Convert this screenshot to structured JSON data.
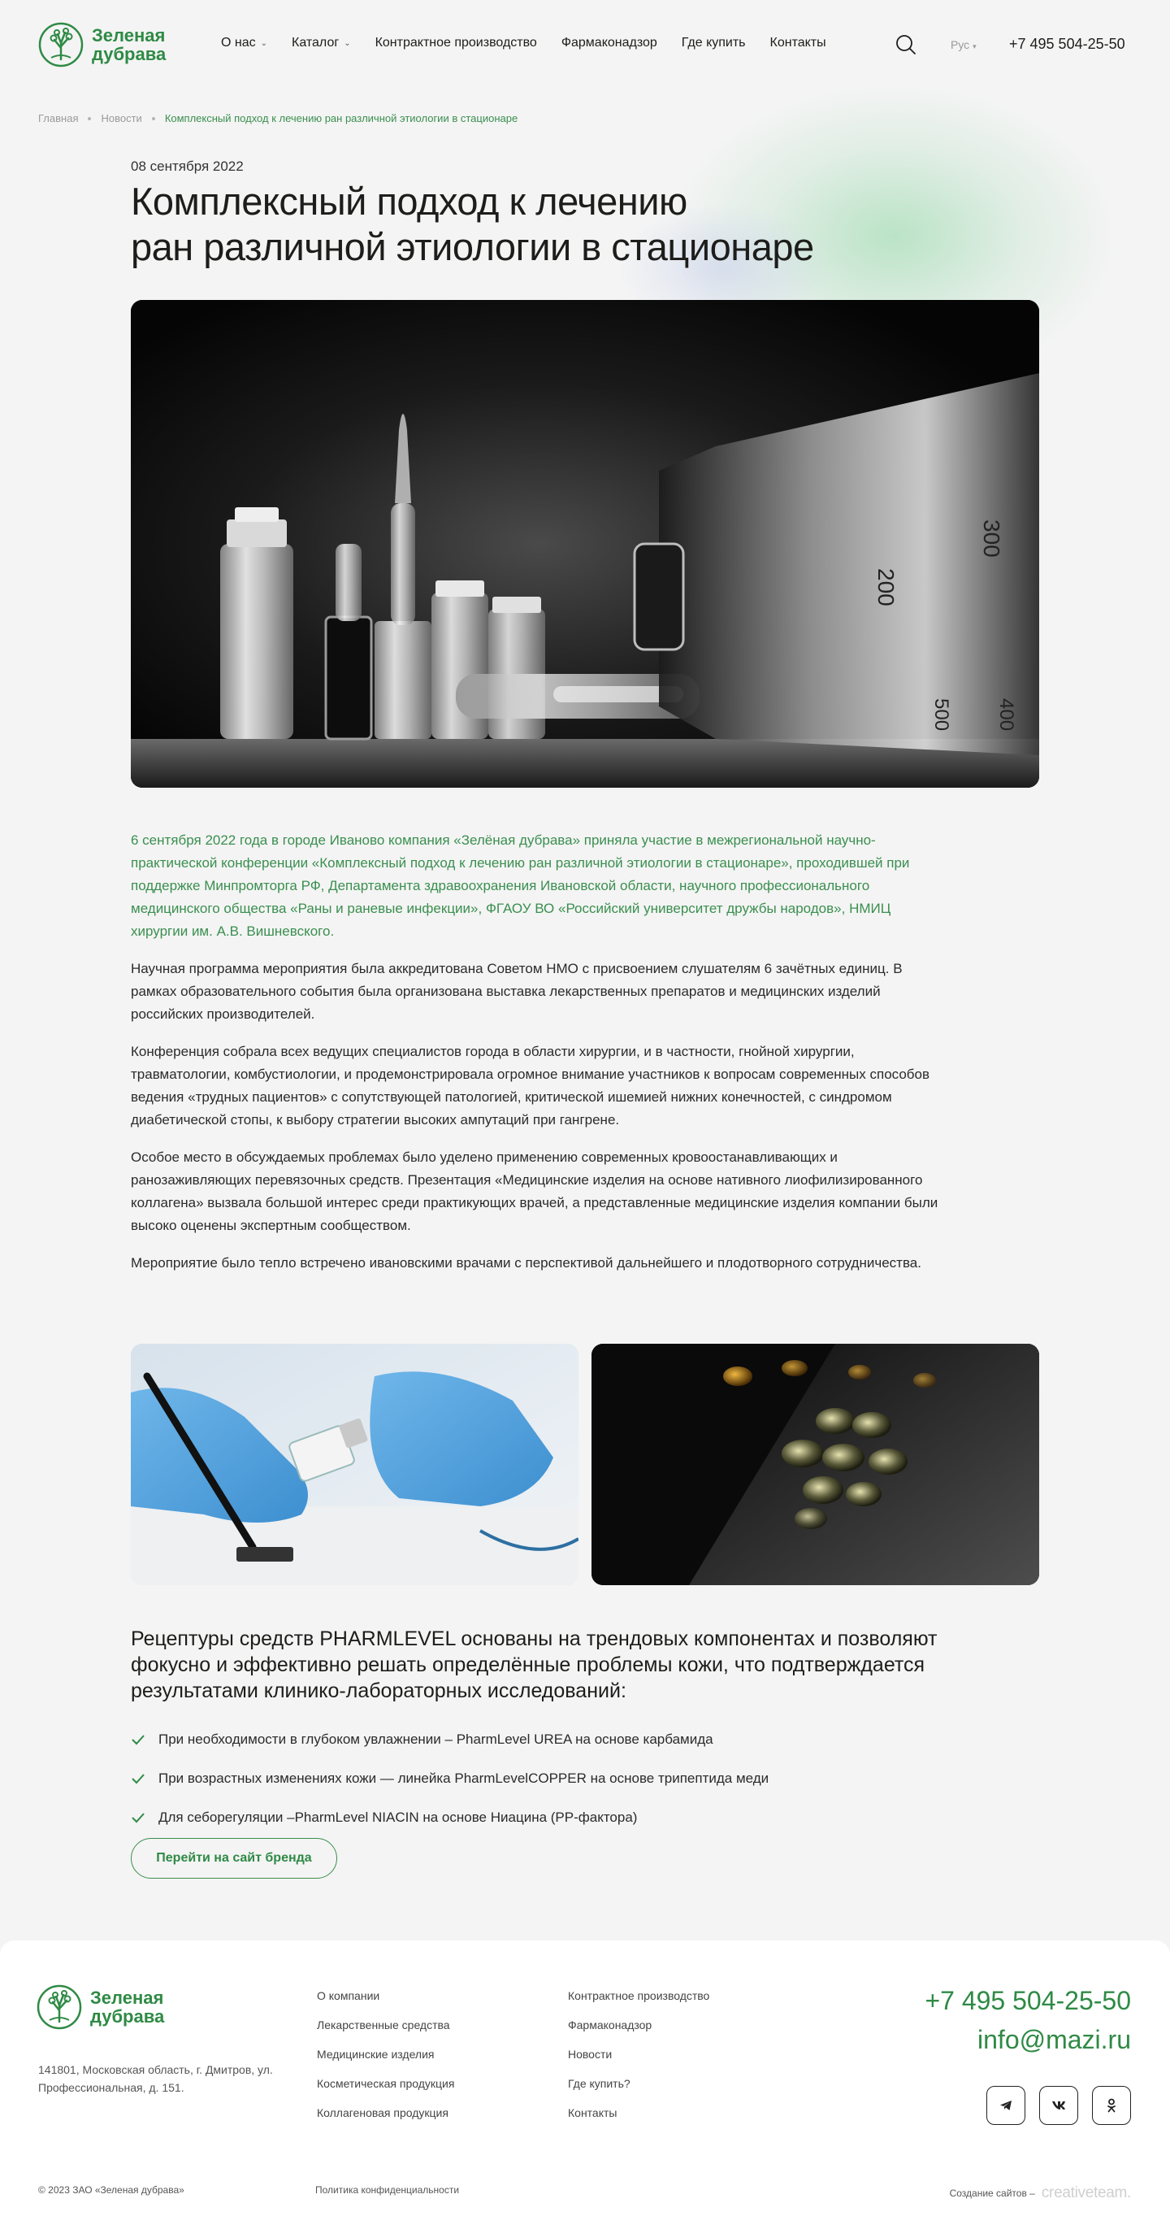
{
  "header": {
    "logo_text": "Зеленая дубрава",
    "nav": [
      {
        "label": "О нас",
        "has_dropdown": true
      },
      {
        "label": "Каталог",
        "has_dropdown": true
      },
      {
        "label": "Контрактное производство",
        "has_dropdown": false
      },
      {
        "label": "Фармаконадзор",
        "has_dropdown": false
      },
      {
        "label": "Где купить",
        "has_dropdown": false
      },
      {
        "label": "Контакты",
        "has_dropdown": false
      }
    ],
    "search_icon": "search-icon",
    "language": "Рус",
    "phone": "+7 495 504-25-50"
  },
  "breadcrumbs": [
    "Главная",
    "Новости",
    "Комплексный подход к лечению ран различной этиологии в стационаре"
  ],
  "article": {
    "date": "08 сентября 2022",
    "title_line1": "Комплексный подход к лечению",
    "title_line2": "ран различной этиологии в стационаре",
    "paragraphs": [
      "6 сентября 2022 года в городе Иваново компания «Зелёная дубрава» приняла участие в межрегиональной научно-практической конференции «Комплексный подход к лечению ран различной этиологии в стационаре», проходившей при поддержке Минпромторга РФ, Департамента здравоохранения Ивановской области, научного профессионального медицинского общества «Раны и раневые инфекции», ФГАОУ ВО «Российский университет дружбы народов», НМИЦ хирургии им. А.В. Вишневского.",
      "Научная программа мероприятия была аккредитована Советом НМО с присвоением слушателям 6 зачётных единиц. В рамках образовательного события была организована выставка лекарственных препаратов и медицинских изделий российских производителей.",
      "Конференция собрала всех ведущих специалистов города в области хирургии, и в частности, гнойной хирургии, травматологии, комбустиологии, и продемонстрировала огромное внимание участников к вопросам современных способов ведения «трудных пациентов» с сопутствующей патологией, критической ишемией нижних конечностей, с синдромом диабетической стопы, к выбору стратегии высоких ампутаций при гангрене.",
      "Особое место в обсуждаемых проблемах было уделено применению современных кровоостанавливающих и ранозаживляющих перевязочных средств. Презентация «Медицинские изделия на основе нативного лиофилизированного коллагена» вызвала большой интерес среди практикующих врачей, а представленные медицинские изделия компании были высоко оценены экспертным сообществом.",
      "Мероприятие было тепло встречено ивановскими врачами с перспективой дальнейшего и плодотворного сотрудничества."
    ],
    "formula_text": "Рецептуры средств PHARMLEVEL основаны на трендовых компонентах и позволяют фокусно и эффективно решать определённые проблемы кожи, что подтверждается результатами клинико-лабораторных исследований:",
    "benefits": [
      "При необходимости в глубоком увлажнении – PharmLevel UREA на основе карбамида",
      "При возрастных изменениях кожи — линейка PharmLevelCOPPER на основе трипептида меди",
      "Для себорегуляции –PharmLevel NIACIN на основе Ниацина (PP-фактора)"
    ],
    "brand_button": "Перейти на сайт бренда"
  },
  "footer": {
    "logo_text": "Зеленая дубрава",
    "address": "141801, Московская область, г. Дмитров, ул. Профессиональная, д. 151.",
    "col1": [
      "О компании",
      "Лекарственные средства",
      "Медицинские изделия",
      "Косметическая продукция",
      "Коллагеновая продукция"
    ],
    "col2": [
      "Контрактное производство",
      "Фармаконадзор",
      "Новости",
      "Где купить?",
      "Контакты"
    ],
    "phone": "+7 495 504-25-50",
    "email": "info@mazi.ru",
    "socials": [
      "telegram-icon",
      "vk-icon",
      "odnoklassniki-icon"
    ],
    "copyright": "© 2023 ЗАО «Зеленая дубрава»",
    "policy": "Политика конфиденциальности",
    "made_by": "Создание сайтов –",
    "studio": "creativeteam."
  },
  "colors": {
    "brand_green": "#2f8a45",
    "background": "#f4f4f4",
    "text": "#1d1d1b"
  }
}
